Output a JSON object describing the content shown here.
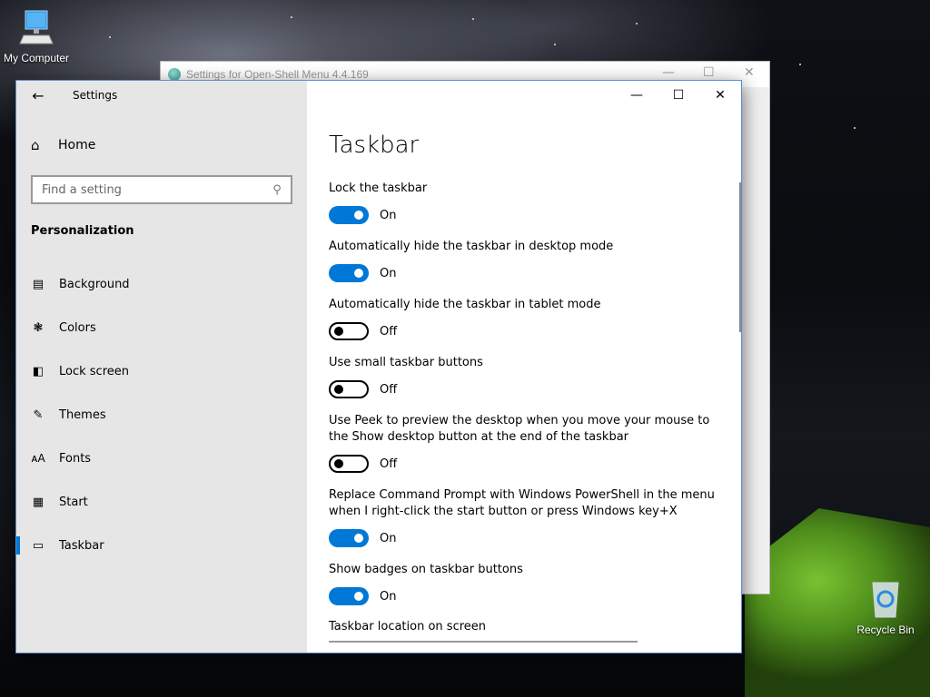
{
  "desktop": {
    "icons": [
      {
        "label": "My Computer",
        "icon": "computer-icon"
      },
      {
        "label": "Recycle Bin",
        "icon": "recycle-bin-icon"
      }
    ],
    "background_window": {
      "title": "Settings for Open-Shell Menu 4.4.169",
      "icon": "globe-icon"
    }
  },
  "window": {
    "title": "Settings",
    "controls": {
      "minimize": "—",
      "maximize": "☐",
      "close": "✕"
    }
  },
  "sidebar": {
    "home_label": "Home",
    "search_placeholder": "Find a setting",
    "section": "Personalization",
    "items": [
      {
        "label": "Background",
        "icon": "picture-icon",
        "active": false
      },
      {
        "label": "Colors",
        "icon": "palette-icon",
        "active": false
      },
      {
        "label": "Lock screen",
        "icon": "lock-screen-icon",
        "active": false
      },
      {
        "label": "Themes",
        "icon": "themes-icon",
        "active": false
      },
      {
        "label": "Fonts",
        "icon": "fonts-icon",
        "active": false
      },
      {
        "label": "Start",
        "icon": "start-icon",
        "active": false
      },
      {
        "label": "Taskbar",
        "icon": "taskbar-icon",
        "active": true
      }
    ]
  },
  "main": {
    "title": "Taskbar",
    "settings": [
      {
        "label": "Lock the taskbar",
        "state": "On"
      },
      {
        "label": "Automatically hide the taskbar in desktop mode",
        "state": "On"
      },
      {
        "label": "Automatically hide the taskbar in tablet mode",
        "state": "Off"
      },
      {
        "label": "Use small taskbar buttons",
        "state": "Off"
      },
      {
        "label": "Use Peek to preview the desktop when you move your mouse to the Show desktop button at the end of the taskbar",
        "state": "Off"
      },
      {
        "label": "Replace Command Prompt with Windows PowerShell in the menu when I right-click the start button or press Windows key+X",
        "state": "On"
      },
      {
        "label": "Show badges on taskbar buttons",
        "state": "On"
      }
    ],
    "location_label": "Taskbar location on screen"
  },
  "colors": {
    "accent": "#0078d7",
    "sidebar_bg": "#e6e6e6"
  }
}
